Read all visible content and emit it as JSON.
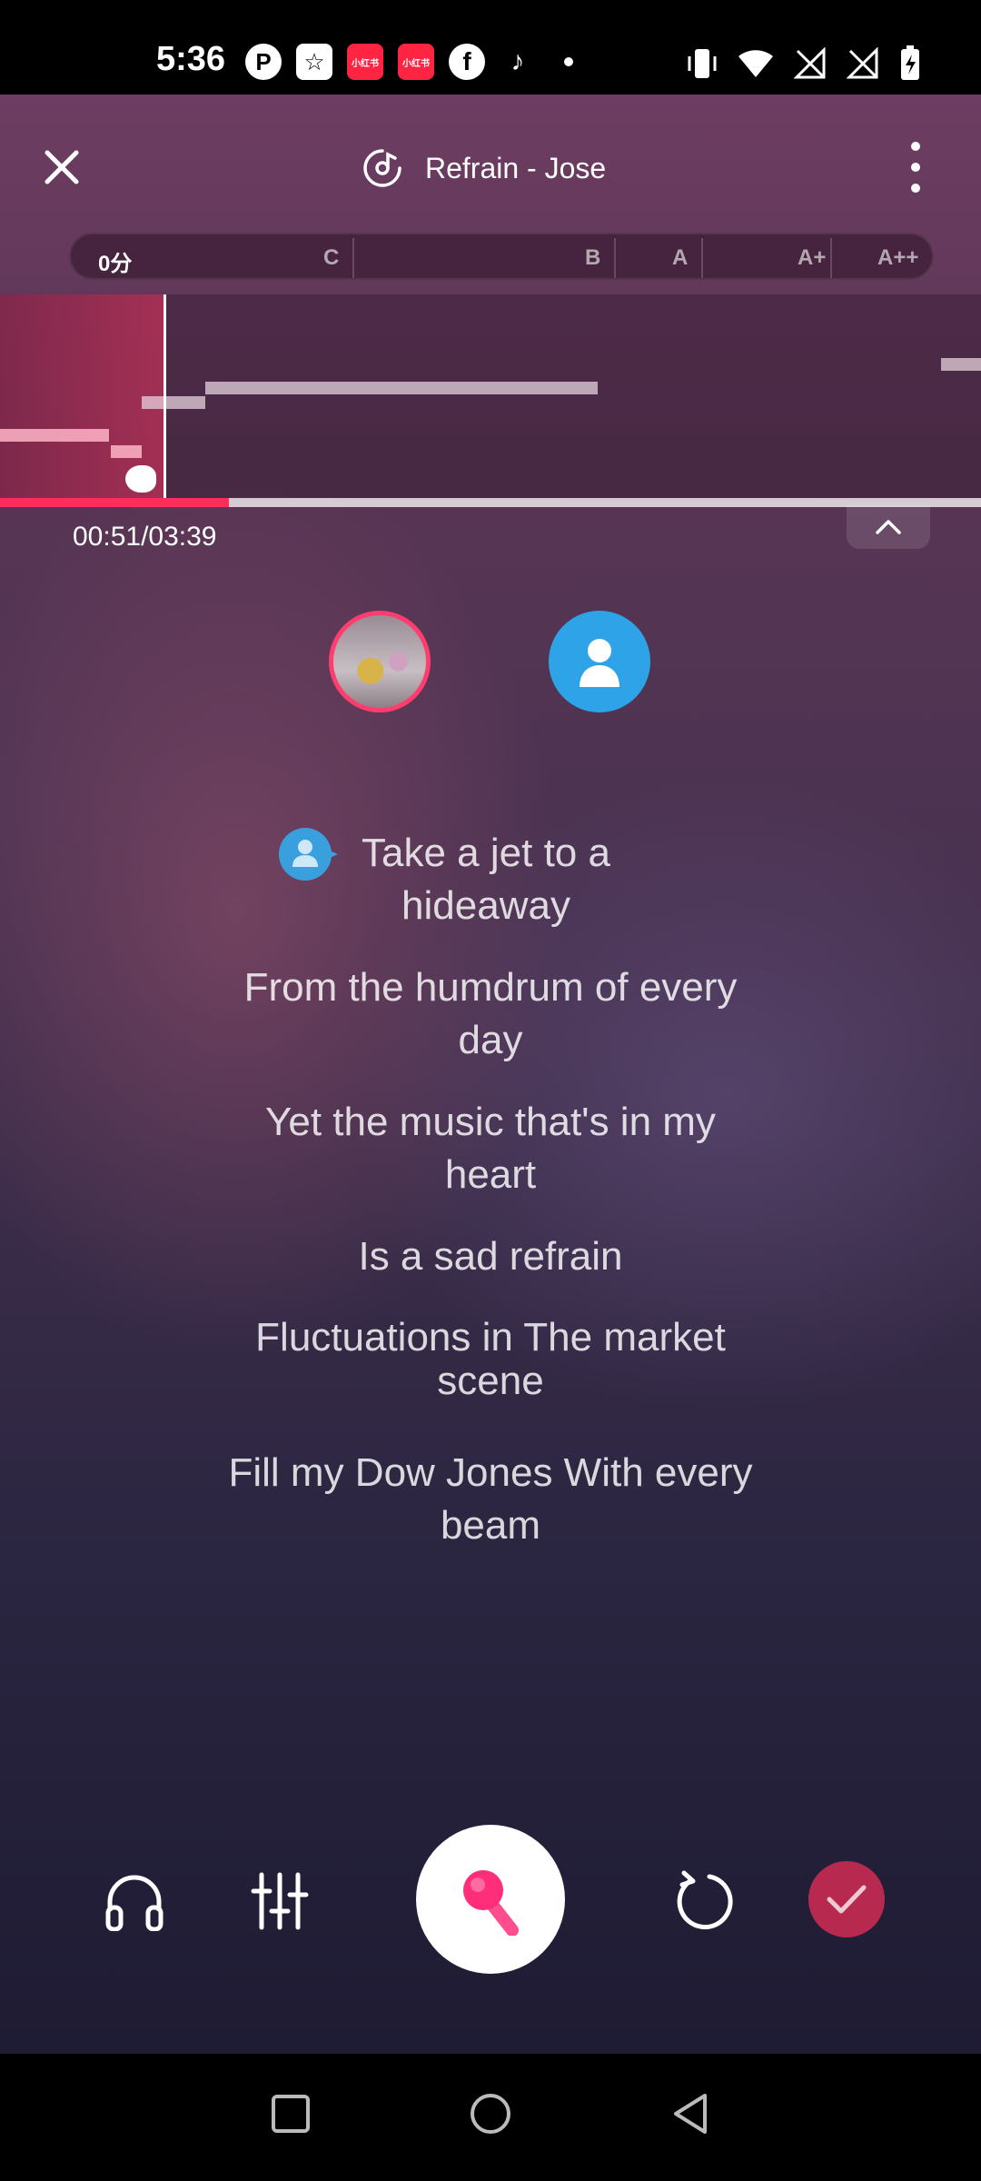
{
  "status_bar": {
    "time": "5:36",
    "left_icons": [
      "p-icon",
      "star-icon",
      "xiaohongshu-icon",
      "xiaohongshu-icon",
      "facebook-icon",
      "tiktok-icon",
      "dot-icon"
    ],
    "xhs_label": "小红书",
    "right_icons": [
      "vibrate-icon",
      "wifi-icon",
      "no-signal-icon",
      "no-signal-icon",
      "battery-charging-icon"
    ]
  },
  "header": {
    "title": "Refrain - Jose"
  },
  "score": {
    "current": "0分",
    "grades": [
      "C",
      "B",
      "A",
      "A+",
      "A++"
    ]
  },
  "progress": {
    "time": "00:51/03:39",
    "fraction": 0.233
  },
  "lyrics": [
    "Take a jet to a hideaway",
    "From the humdrum of every day",
    "Yet the music that's in my heart",
    "Is a sad refrain",
    "Fluctuations in The market scene",
    "Fill my Dow Jones With every beam"
  ],
  "colors": {
    "accent": "#ff2d5a",
    "avatar_blue": "#2ea3e8",
    "finish": "#b8294f"
  },
  "controls": [
    "headphones-icon",
    "equalizer-icon",
    "microphone-icon",
    "restart-icon",
    "check-icon"
  ]
}
